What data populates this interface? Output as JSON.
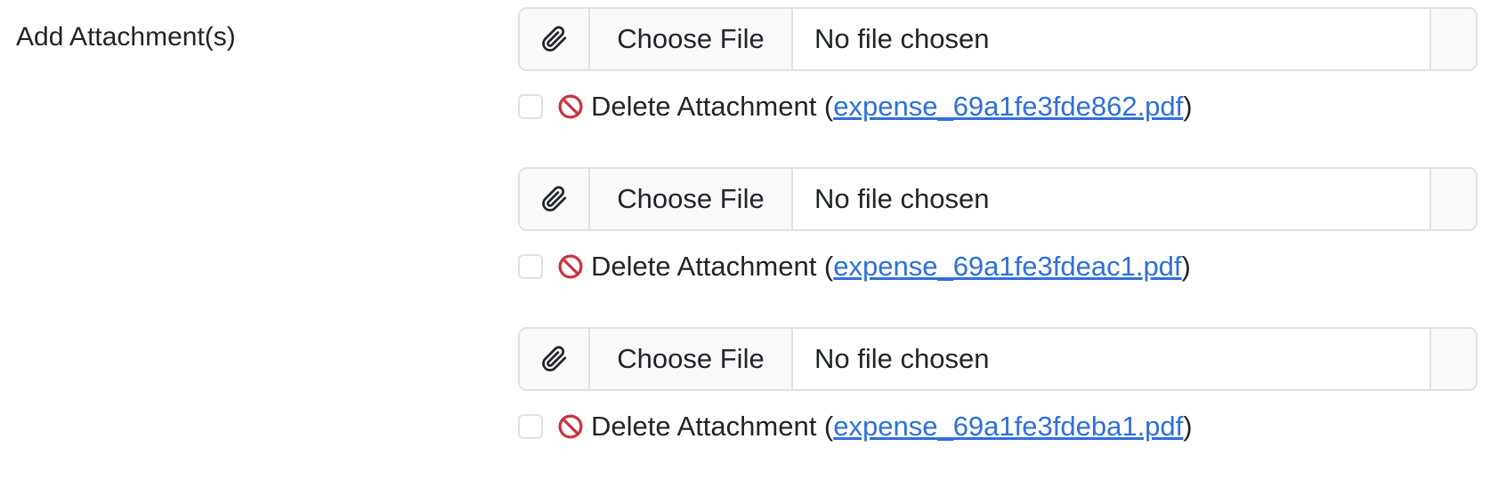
{
  "form": {
    "label": "Add Attachment(s)",
    "attachments": [
      {
        "choose_label": "Choose File",
        "status": "No file chosen",
        "delete_label": "Delete Attachment (",
        "filename": "expense_69a1fe3fde862.pdf",
        "close_paren": ")"
      },
      {
        "choose_label": "Choose File",
        "status": "No file chosen",
        "delete_label": "Delete Attachment (",
        "filename": "expense_69a1fe3fdeac1.pdf",
        "close_paren": ")"
      },
      {
        "choose_label": "Choose File",
        "status": "No file chosen",
        "delete_label": "Delete Attachment (",
        "filename": "expense_69a1fe3fdeba1.pdf",
        "close_paren": ")"
      }
    ]
  },
  "icons": {
    "attach": "paperclip-icon",
    "delete": "ban-icon"
  },
  "colors": {
    "link": "#2f6fdb",
    "delete_icon": "#c9343f",
    "border": "#dee2e6",
    "addon_bg": "#f8f9fa"
  }
}
